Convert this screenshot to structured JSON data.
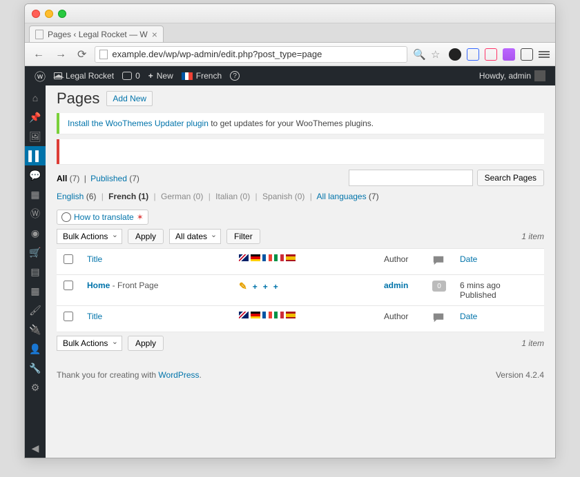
{
  "browser": {
    "tab_title": "Pages ‹ Legal Rocket — W",
    "url": "example.dev/wp/wp-admin/edit.php?post_type=page",
    "url_hint": ""
  },
  "adminbar": {
    "site": "Legal Rocket",
    "comments": "0",
    "new": "New",
    "lang": "French",
    "greeting": "Howdy, admin"
  },
  "page": {
    "title": "Pages",
    "add_new": "Add New"
  },
  "notice_woothemes": {
    "link": "Install the WooThemes Updater plugin",
    "text": " to get updates for your WooThemes plugins."
  },
  "statuses": {
    "all": "All",
    "all_count": " (7)",
    "published": "Published",
    "published_count": " (7)"
  },
  "langs": {
    "english": "English",
    "english_count": " (6)",
    "french": "French (1)",
    "german": "German (0)",
    "italian": "Italian (0)",
    "spanish": "Spanish (0)",
    "alllang": "All languages",
    "alllang_count": " (7)"
  },
  "search": {
    "button": "Search Pages",
    "value": ""
  },
  "howto": "How to translate",
  "bulk": {
    "label": "Bulk Actions",
    "apply": "Apply"
  },
  "datefilter": {
    "label": "All dates",
    "filter": "Filter"
  },
  "itemcount": "1 item",
  "columns": {
    "title": "Title",
    "author": "Author",
    "date": "Date"
  },
  "rows": [
    {
      "title": "Home",
      "suffix": " - Front Page",
      "author": "admin",
      "comments": "0",
      "date_line1": "6 mins ago",
      "date_line2": "Published"
    }
  ],
  "footer": {
    "thankyou": "Thank you for creating with ",
    "wp": "WordPress",
    "period": ".",
    "version": "Version 4.2.4"
  }
}
